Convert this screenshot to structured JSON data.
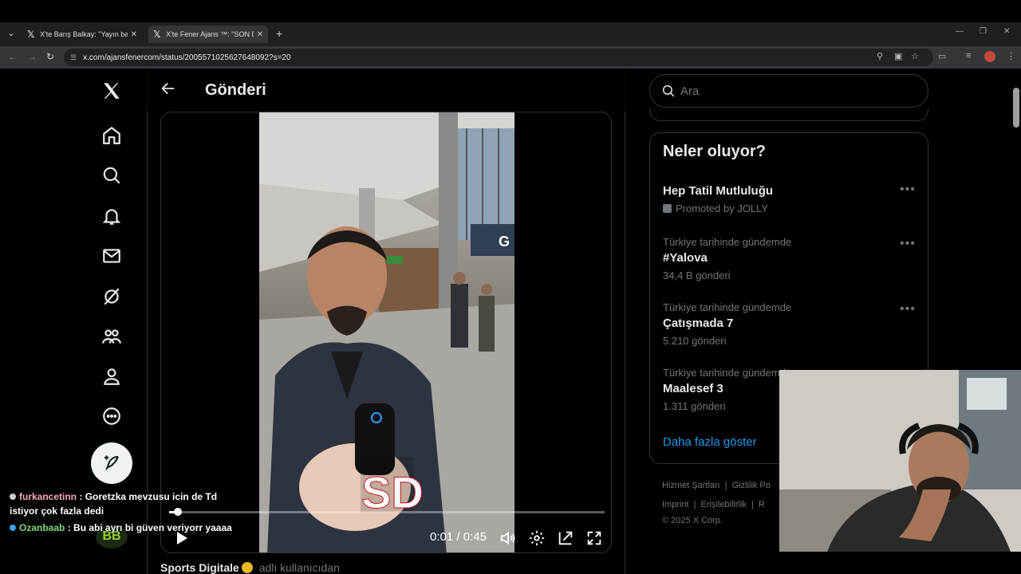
{
  "browser": {
    "tabs": [
      {
        "title": "X'te Barış Balkay: \"Yayın başladı",
        "active": false
      },
      {
        "title": "X'te Fener Ajans ™: \"SON DAKİ",
        "active": true
      }
    ],
    "new_tab": "+",
    "url": "x.com/ajansfenercom/status/2005571025627648092?s=20"
  },
  "post": {
    "header_title": "Gönderi",
    "video": {
      "current_time": "0:01",
      "separator": "/",
      "duration": "0:45",
      "progress": 0.02,
      "watermark": "SD"
    },
    "author_name": "Sports Digitale",
    "author_handle": "adlı kullanıcıdan"
  },
  "sidebar": {
    "search_placeholder": "Ara",
    "trends_title": "Neler oluyor?",
    "trends": [
      {
        "context": "",
        "name": "Hep Tatil Mutluluğu",
        "count": "Promoted by JOLLY",
        "promoted": true
      },
      {
        "context": "Türkiye tarihinde gündemde",
        "name": "#Yalova",
        "count": "34,4 B gönderi",
        "promoted": false
      },
      {
        "context": "Türkiye tarihinde gündemde",
        "name": "Çatışmada 7",
        "count": "5.210 gönderi",
        "promoted": false
      },
      {
        "context": "Türkiye tarihinde gündemde",
        "name": "Maalesef 3",
        "count": "1.311 gönderi",
        "promoted": false
      }
    ],
    "show_more": "Daha fazla göster",
    "footer": {
      "row1": [
        "Hizmet Şartları",
        "Gizlilik Po"
      ],
      "row2": [
        "Imprint",
        "Erişilebilirlik",
        "R"
      ],
      "copyright": "© 2025 X Corp."
    }
  },
  "chat": [
    {
      "user": "furkancetinn",
      "message": ": Goretzka mevzusu icin de Td",
      "continuation": "istiyor çok fazla dedi",
      "color": "#f4a9b8"
    },
    {
      "user": "Ozanbaab",
      "message": ": Bu abi ayrı bi güven veriyorr yaaaa",
      "color": "#7ddc7d"
    }
  ],
  "overlay_logo": "BB",
  "colors": {
    "accent": "#1d9bf0",
    "background": "#000000",
    "border": "#2f3336",
    "muted": "#71767b"
  }
}
